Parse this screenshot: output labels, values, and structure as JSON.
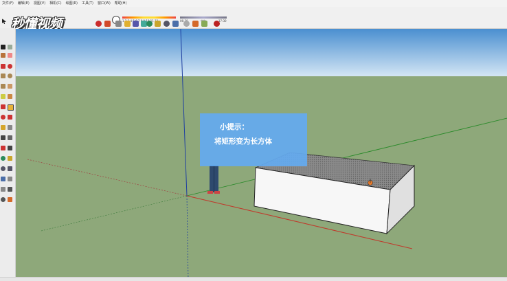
{
  "menubar": {
    "items": [
      "文件(F)",
      "编辑(E)",
      "视图(V)",
      "相机(C)",
      "绘图(R)",
      "工具(T)",
      "窗口(W)",
      "帮助(H)"
    ]
  },
  "toolbar": {
    "logo_text": "秒懂视频",
    "shadow_months": "1 2 3 4 5 6 7 8 9 10 11 12",
    "shadow_time_start": "06:30",
    "shadow_time_mid": "中午",
    "shadow_time_end": "17:30"
  },
  "hint": {
    "line1": "小提示：",
    "line2": "将矩形变为长方体"
  },
  "colors": {
    "sky_top": "#4a8fd0",
    "sky_bottom": "#d6e7f5",
    "ground": "#8ea87a",
    "hint_bg": "#64aaf0",
    "axis_red": "#c0392b",
    "axis_green": "#2a8a2a",
    "axis_blue": "#1f3fa0"
  },
  "icons": [
    "select-icon",
    "eraser-icon",
    "paint-icon",
    "line-icon",
    "rectangle-icon",
    "circle-icon",
    "pushpull-icon",
    "move-icon",
    "rotate-icon",
    "orbit-icon",
    "pan-icon",
    "zoom-icon",
    "zoom-extents-icon"
  ]
}
